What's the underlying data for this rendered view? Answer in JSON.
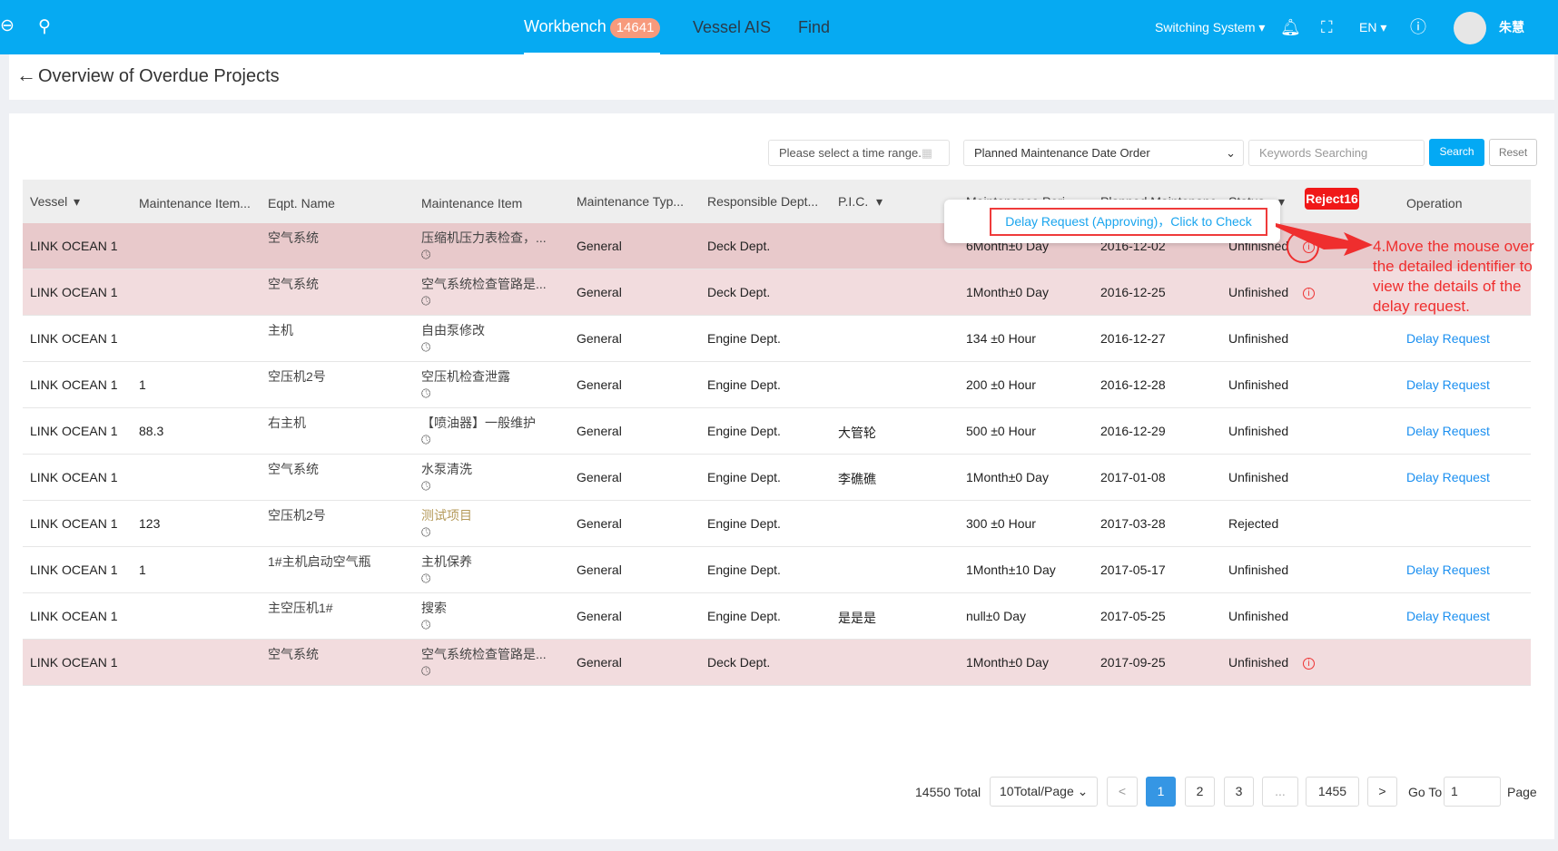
{
  "header": {
    "nav": [
      {
        "label": "Workbench",
        "badge": "14641"
      },
      {
        "label": "Vessel AIS"
      },
      {
        "label": "Find"
      }
    ],
    "switch_system": "Switching System",
    "lang": "EN",
    "user": "朱慧"
  },
  "page": {
    "title": "Overview of Overdue Projects"
  },
  "filters": {
    "time_placeholder": "Please select a time range.",
    "order": "Planned Maintenance Date Order",
    "keyword_placeholder": "Keywords Searching",
    "search": "Search",
    "reset": "Reset"
  },
  "table": {
    "columns": [
      "Vessel",
      "Maintenance Item...",
      "Eqpt. Name",
      "Maintenance Item",
      "Maintenance Typ...",
      "Responsible Dept...",
      "P.I.C.",
      "Maintenance Peri",
      "Planned Maintenanc",
      "Status",
      "Operation"
    ],
    "rows": [
      [
        "LINK OCEAN 1",
        "",
        "空气系统",
        "压缩机压力表检查，...",
        "General",
        "Deck Dept.",
        "",
        "6Month±0 Day",
        "2016-12-02",
        "Unfinished",
        ""
      ],
      [
        "LINK OCEAN 1",
        "",
        "空气系统",
        "空气系统检查管路是...",
        "General",
        "Deck Dept.",
        "",
        "1Month±0 Day",
        "2016-12-25",
        "Unfinished",
        ""
      ],
      [
        "LINK OCEAN 1",
        "",
        "主机",
        "自由泵修改",
        "General",
        "Engine Dept.",
        "",
        "134 ±0 Hour",
        "2016-12-27",
        "Unfinished",
        "Delay Request"
      ],
      [
        "LINK OCEAN 1",
        "1",
        "空压机2号",
        "空压机检查泄露",
        "General",
        "Engine Dept.",
        "",
        "200 ±0 Hour",
        "2016-12-28",
        "Unfinished",
        "Delay Request"
      ],
      [
        "LINK OCEAN 1",
        "88.3",
        "右主机",
        "【喷油器】一般维护",
        "General",
        "Engine Dept.",
        "大管轮",
        "500 ±0 Hour",
        "2016-12-29",
        "Unfinished",
        "Delay Request"
      ],
      [
        "LINK OCEAN 1",
        "",
        "空气系统",
        "水泵清洗",
        "General",
        "Engine Dept.",
        "李礁礁",
        "1Month±0 Day",
        "2017-01-08",
        "Unfinished",
        "Delay Request"
      ],
      [
        "LINK OCEAN 1",
        "123",
        "空压机2号",
        "测试项目",
        "General",
        "Engine Dept.",
        "",
        "300 ±0 Hour",
        "2017-03-28",
        "Rejected",
        ""
      ],
      [
        "LINK OCEAN 1",
        "1",
        "1#主机启动空气瓶",
        "主机保养",
        "General",
        "Engine Dept.",
        "",
        "1Month±10 Day",
        "2017-05-17",
        "Unfinished",
        "Delay Request"
      ],
      [
        "LINK OCEAN 1",
        "",
        "主空压机1#",
        "搜索",
        "General",
        "Engine Dept.",
        "是是是",
        "null±0 Day",
        "2017-05-25",
        "Unfinished",
        "Delay Request"
      ],
      [
        "LINK OCEAN 1",
        "",
        "空气系统",
        "空气系统检查管路是...",
        "General",
        "Deck Dept.",
        "",
        "1Month±0 Day",
        "2017-09-25",
        "Unfinished",
        ""
      ]
    ],
    "row_highlight": [
      "#e8c9cb",
      "#f2dcde",
      "",
      "",
      "",
      "",
      "",
      "",
      "",
      "#f2dcde"
    ],
    "info_rows": [
      0,
      1,
      9
    ]
  },
  "popup": {
    "text": "Delay Request (Approving)，Click to Check"
  },
  "reject_badge": "Reject16",
  "annotation": "4.Move the mouse over the detailed identifier to view the details of the delay request.",
  "pagination": {
    "total": "14550 Total",
    "page_size": "10Total/Page",
    "prev": "<",
    "pages": [
      "1",
      "2",
      "3",
      "...",
      "1455"
    ],
    "next": ">",
    "goto_label": "Go To",
    "goto_value": "1",
    "page_label": "Page",
    "current": "1"
  },
  "colors": {
    "brand": "#06aaf2",
    "annotation": "#ef2e2e",
    "link": "#1a8ff0"
  }
}
